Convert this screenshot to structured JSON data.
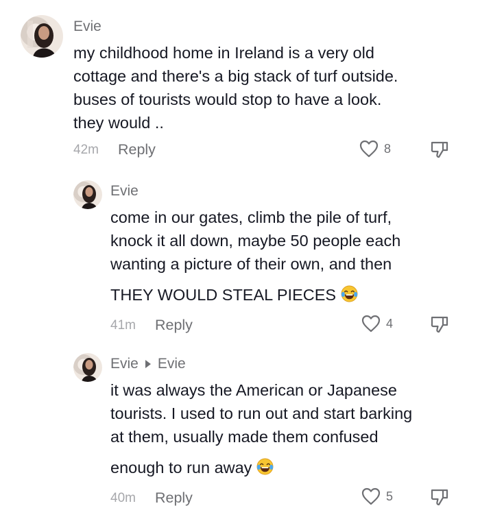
{
  "comments": [
    {
      "username": "Evie",
      "lines": [
        "my childhood home in Ireland is a very old",
        "cottage and there's a big stack of turf outside.",
        "buses of tourists would stop to have a look.",
        "they would .."
      ],
      "time": "42m",
      "reply_label": "Reply",
      "likes": "8"
    },
    {
      "username": "Evie",
      "lines": [
        "come in our gates, climb the pile of turf,",
        "knock it all down, maybe 50 people each",
        "wanting a picture of their own, and then"
      ],
      "emoji_line": "THEY WOULD STEAL PIECES",
      "time": "41m",
      "reply_label": "Reply",
      "likes": "4"
    },
    {
      "username": "Evie",
      "reply_to": "Evie",
      "lines": [
        "it was always the American or Japanese",
        "tourists. I used to run out and start barking",
        "at them, usually made them confused"
      ],
      "emoji_line": "enough to run away",
      "time": "40m",
      "reply_label": "Reply",
      "likes": "5"
    }
  ],
  "icons": {
    "like": "heart-outline-icon",
    "dislike": "thumbs-down-outline-icon",
    "emoji": "laughing-tears-emoji"
  },
  "colors": {
    "text": "#161823",
    "secondary": "#6e6f73",
    "muted": "#a6a7ab"
  }
}
